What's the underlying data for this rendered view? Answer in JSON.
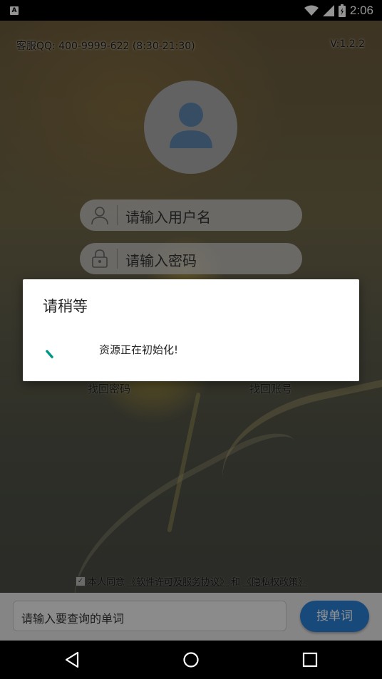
{
  "status_bar": {
    "time": "2:06",
    "app_icon_letter": "A"
  },
  "header": {
    "service_text": "客服QQ: 400-9999-622 (8:30-21:30)",
    "version": "V:1.2.2"
  },
  "login": {
    "username_placeholder": "请输入用户名",
    "password_placeholder": "请输入密码",
    "find_password": "找回密码",
    "find_account": "找回账号"
  },
  "agreement": {
    "prefix": "本人同意",
    "license_link": "《软件许可及服务协议》",
    "conjunction": "和",
    "privacy_link": "《隐私权政策》"
  },
  "search": {
    "placeholder": "请输入要查询的单词",
    "button_label": "搜单词"
  },
  "dialog": {
    "title": "请稍等",
    "message": "资源正在初始化!"
  },
  "colors": {
    "accent_blue": "#2a7fd4",
    "spinner_teal": "#009688",
    "dialog_bg": "#ffffff"
  },
  "icons": [
    "wifi-icon",
    "cell-signal-icon",
    "battery-icon",
    "user-icon",
    "lock-icon",
    "back-icon",
    "home-icon",
    "recents-icon"
  ]
}
